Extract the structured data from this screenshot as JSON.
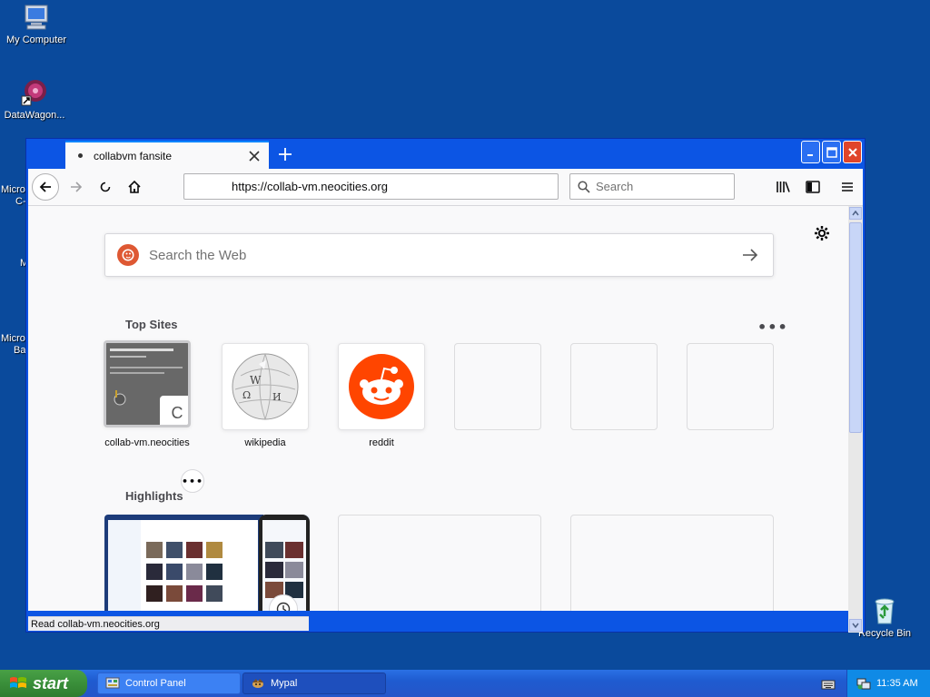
{
  "desktop": {
    "icons": [
      {
        "label": "My Computer",
        "icon": "computer-icon"
      },
      {
        "label": "DataWagon...",
        "icon": "datawagon-icon"
      },
      {
        "label": "Recycle Bin",
        "icon": "recycle-bin-icon"
      }
    ],
    "partial_labels": [
      "Micro",
      "C-",
      "M",
      "Micro",
      "Ba"
    ]
  },
  "browser": {
    "tab": {
      "title": "collabvm fansite"
    },
    "url": "https://collab-vm.neocities.org",
    "search_placeholder": "Search",
    "newtab": {
      "web_search_placeholder": "Search the Web",
      "top_sites_title": "Top Sites",
      "top_sites": [
        {
          "label": "collab-vm.neocities",
          "thumb_letter": "C"
        },
        {
          "label": "wikipedia"
        },
        {
          "label": "reddit"
        },
        {
          "label": ""
        },
        {
          "label": ""
        },
        {
          "label": ""
        }
      ],
      "highlights_title": "Highlights"
    },
    "status_text": "Read collab-vm.neocities.org"
  },
  "taskbar": {
    "start_label": "start",
    "items": [
      {
        "label": "Control Panel"
      },
      {
        "label": "Mypal"
      }
    ],
    "clock": "11:35 AM"
  },
  "colors": {
    "desktop": "#0a4a9c",
    "window_title": "#0c55e4",
    "reddit": "#ff4500",
    "duckduckgo": "#de5833"
  }
}
